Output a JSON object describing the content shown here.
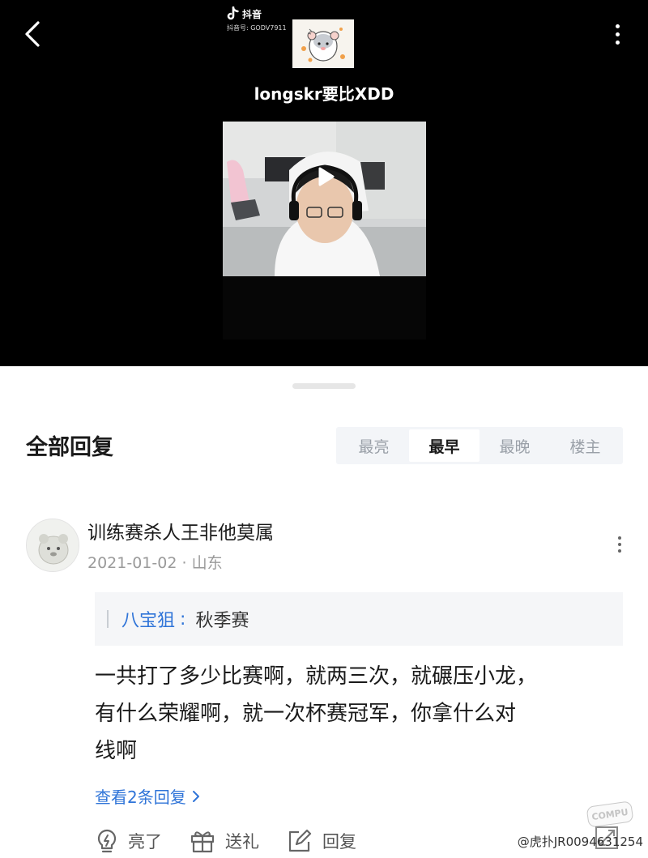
{
  "video": {
    "title": "longskr要比XDD",
    "tiktok_brand": "抖音",
    "tiktok_id": "抖音号: GODV7911"
  },
  "comments_section": {
    "title": "全部回复",
    "sort_tabs": [
      {
        "label": "最亮",
        "active": false
      },
      {
        "label": "最早",
        "active": true
      },
      {
        "label": "最晚",
        "active": false
      },
      {
        "label": "楼主",
        "active": false
      }
    ]
  },
  "comment": {
    "username": "训练赛杀人王非他莫属",
    "date": "2021-01-02",
    "location": "山东",
    "quote_author": "八宝狙",
    "quote_text": "秋季赛",
    "body_lines": [
      "一共打了多少比赛啊，就两三次，就碾压小龙，",
      "有什么荣耀啊，就一次杯赛冠军，你拿什么对",
      "线啊"
    ],
    "view_replies": "查看2条回复",
    "actions": {
      "like": "亮了",
      "gift": "送礼",
      "reply": "回复"
    }
  },
  "watermark": {
    "text": "@虎扑JR0094631254",
    "logo": "COMPU"
  },
  "colors": {
    "link_blue": "#2f74d8",
    "muted_gray": "#9a9a9a",
    "video_bg": "#000000"
  },
  "icons": [
    "back-arrow-icon",
    "more-vertical-icon",
    "tiktok-logo-icon",
    "play-icon",
    "lightbulb-icon",
    "gift-icon",
    "edit-icon",
    "chevron-right-icon",
    "expand-icon"
  ]
}
